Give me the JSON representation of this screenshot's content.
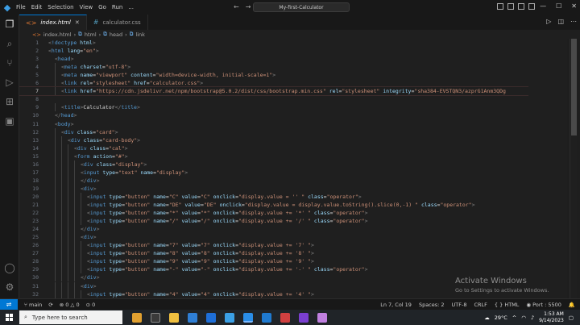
{
  "titlebar": {
    "menu": [
      "File",
      "Edit",
      "Selection",
      "View",
      "Go",
      "Run",
      "..."
    ],
    "search": "My-first-Calculator"
  },
  "tabs": [
    {
      "label": "index.html",
      "active": true
    },
    {
      "label": "calculator.css",
      "active": false
    }
  ],
  "breadcrumb": [
    "index.html",
    "html",
    "head",
    "link"
  ],
  "code_lines": [
    {
      "n": "1",
      "indent": 0,
      "html": "<span class='t'>&lt;</span><span class='tag'>!doctype</span> <span class='attr'>html</span><span class='t'>&gt;</span>"
    },
    {
      "n": "2",
      "indent": 0,
      "html": "<span class='t'>&lt;</span><span class='tag'>html</span> <span class='attr'>lang</span><span class='txt'>=</span><span class='str'>\"en\"</span><span class='t'>&gt;</span>"
    },
    {
      "n": "3",
      "indent": 1,
      "html": "<span class='t'>&lt;</span><span class='tag'>head</span><span class='t'>&gt;</span>"
    },
    {
      "n": "4",
      "indent": 2,
      "html": "<span class='t'>&lt;</span><span class='tag'>meta</span> <span class='attr'>charset</span><span class='txt'>=</span><span class='str'>\"utf-8\"</span><span class='t'>&gt;</span>"
    },
    {
      "n": "5",
      "indent": 2,
      "html": "<span class='t'>&lt;</span><span class='tag'>meta</span> <span class='attr'>name</span><span class='txt'>=</span><span class='str'>\"viewport\"</span> <span class='attr'>content</span><span class='txt'>=</span><span class='str'>\"width=device-width, initial-scale=1\"</span><span class='t'>&gt;</span>"
    },
    {
      "n": "6",
      "indent": 2,
      "html": "<span class='t'>&lt;</span><span class='tag'>link</span> <span class='attr'>rel</span><span class='txt'>=</span><span class='str'>\"stylesheet\"</span> <span class='attr'>href</span><span class='txt'>=</span><span class='str'>\"calculator.css\"</span><span class='t'>&gt;</span>"
    },
    {
      "n": "7",
      "indent": 2,
      "current": true,
      "html": "<span class='t'>&lt;</span><span class='tag'>link</span> <span class='attr'>href</span><span class='txt'>=</span><span class='str'>\"https://cdn.jsdelivr.net/npm/bootstrap@5.0.2/dist/css/bootstrap.min.css\"</span> <span class='attr'>rel</span><span class='txt'>=</span><span class='str'>\"stylesheet\"</span> <span class='attr'>integrity</span><span class='txt'>=</span><span class='str'>\"sha384-EVSTQN3/azprG1Anm3QDg</span>"
    },
    {
      "n": "8",
      "indent": 0,
      "html": ""
    },
    {
      "n": "9",
      "indent": 2,
      "html": "<span class='t'>&lt;</span><span class='tag'>title</span><span class='t'>&gt;</span><span class='txt'>Calculator</span><span class='t'>&lt;/</span><span class='tag'>title</span><span class='t'>&gt;</span>"
    },
    {
      "n": "10",
      "indent": 1,
      "html": "<span class='t'>&lt;/</span><span class='tag'>head</span><span class='t'>&gt;</span>"
    },
    {
      "n": "11",
      "indent": 1,
      "html": "<span class='t'>&lt;</span><span class='tag'>body</span><span class='t'>&gt;</span>"
    },
    {
      "n": "12",
      "indent": 2,
      "html": "<span class='t'>&lt;</span><span class='tag'>div</span> <span class='attr'>class</span><span class='txt'>=</span><span class='str'>\"card\"</span><span class='t'>&gt;</span>"
    },
    {
      "n": "13",
      "indent": 3,
      "html": "<span class='t'>&lt;</span><span class='tag'>div</span> <span class='attr'>class</span><span class='txt'>=</span><span class='str'>\"card-body\"</span><span class='t'>&gt;</span>"
    },
    {
      "n": "14",
      "indent": 4,
      "html": "<span class='t'>&lt;</span><span class='tag'>div</span> <span class='attr'>class</span><span class='txt'>=</span><span class='str'>\"cal\"</span><span class='t'>&gt;</span>"
    },
    {
      "n": "15",
      "indent": 4,
      "html": "<span class='t'>&lt;</span><span class='tag'>form</span> <span class='attr'>action</span><span class='txt'>=</span><span class='str'>\"#\"</span><span class='t'>&gt;</span>"
    },
    {
      "n": "16",
      "indent": 5,
      "html": "<span class='t'>&lt;</span><span class='tag'>div</span> <span class='attr'>class</span><span class='txt'>=</span><span class='str'>\"display\"</span><span class='t'>&gt;</span>"
    },
    {
      "n": "17",
      "indent": 5,
      "html": "<span class='t'>&lt;</span><span class='tag'>input</span> <span class='attr'>type</span><span class='txt'>=</span><span class='str'>\"text\"</span> <span class='attr'>name</span><span class='txt'>=</span><span class='str'>\"display\"</span><span class='t'>&gt;</span>"
    },
    {
      "n": "18",
      "indent": 5,
      "html": "<span class='t'>&lt;/</span><span class='tag'>div</span><span class='t'>&gt;</span>"
    },
    {
      "n": "19",
      "indent": 5,
      "html": "<span class='t'>&lt;</span><span class='tag'>div</span><span class='t'>&gt;</span>"
    },
    {
      "n": "20",
      "indent": 6,
      "html": "<span class='t'>&lt;</span><span class='tag'>input</span> <span class='attr'>type</span><span class='txt'>=</span><span class='str'>\"button\"</span> <span class='attr'>name</span><span class='txt'>=</span><span class='str'>\"C\"</span> <span class='attr'>value</span><span class='txt'>=</span><span class='str'>\"C\"</span> <span class='attr'>onclick</span><span class='txt'>=</span><span class='str'>\"display.value = '' \"</span> <span class='attr'>class</span><span class='txt'>=</span><span class='str'>\"operator\"</span><span class='t'>&gt;</span>"
    },
    {
      "n": "21",
      "indent": 6,
      "html": "<span class='t'>&lt;</span><span class='tag'>input</span> <span class='attr'>type</span><span class='txt'>=</span><span class='str'>\"button\"</span> <span class='attr'>name</span><span class='txt'>=</span><span class='str'>\"DE\"</span> <span class='attr'>value</span><span class='txt'>=</span><span class='str'>\"DE\"</span> <span class='attr'>onclick</span><span class='txt'>=</span><span class='str'>\"display.value = display.value.toString().slice(0,-1) \"</span> <span class='attr'>class</span><span class='txt'>=</span><span class='str'>\"operator\"</span><span class='t'>&gt;</span>"
    },
    {
      "n": "22",
      "indent": 6,
      "html": "<span class='t'>&lt;</span><span class='tag'>input</span> <span class='attr'>type</span><span class='txt'>=</span><span class='str'>\"button\"</span> <span class='attr'>name</span><span class='txt'>=</span><span class='str'>\"*\"</span> <span class='attr'>value</span><span class='txt'>=</span><span class='str'>\"*\"</span> <span class='attr'>onclick</span><span class='txt'>=</span><span class='str'>\"display.value += '*' \"</span> <span class='attr'>class</span><span class='txt'>=</span><span class='str'>\"operator\"</span><span class='t'>&gt;</span>"
    },
    {
      "n": "23",
      "indent": 6,
      "html": "<span class='t'>&lt;</span><span class='tag'>input</span> <span class='attr'>type</span><span class='txt'>=</span><span class='str'>\"button\"</span> <span class='attr'>name</span><span class='txt'>=</span><span class='str'>\"/\"</span> <span class='attr'>value</span><span class='txt'>=</span><span class='str'>\"/\"</span> <span class='attr'>onclick</span><span class='txt'>=</span><span class='str'>\"display.value += '/' \"</span> <span class='attr'>class</span><span class='txt'>=</span><span class='str'>\"operator\"</span><span class='t'>&gt;</span>"
    },
    {
      "n": "24",
      "indent": 5,
      "html": "<span class='t'>&lt;/</span><span class='tag'>div</span><span class='t'>&gt;</span>"
    },
    {
      "n": "25",
      "indent": 5,
      "html": "<span class='t'>&lt;</span><span class='tag'>div</span><span class='t'>&gt;</span>"
    },
    {
      "n": "26",
      "indent": 6,
      "html": "<span class='t'>&lt;</span><span class='tag'>input</span> <span class='attr'>type</span><span class='txt'>=</span><span class='str'>\"button\"</span> <span class='attr'>name</span><span class='txt'>=</span><span class='str'>\"7\"</span> <span class='attr'>value</span><span class='txt'>=</span><span class='str'>\"7\"</span> <span class='attr'>onclick</span><span class='txt'>=</span><span class='str'>\"display.value += '7' \"</span><span class='t'>&gt;</span>"
    },
    {
      "n": "27",
      "indent": 6,
      "html": "<span class='t'>&lt;</span><span class='tag'>input</span> <span class='attr'>type</span><span class='txt'>=</span><span class='str'>\"button\"</span> <span class='attr'>name</span><span class='txt'>=</span><span class='str'>\"8\"</span> <span class='attr'>value</span><span class='txt'>=</span><span class='str'>\"8\"</span> <span class='attr'>onclick</span><span class='txt'>=</span><span class='str'>\"display.value += '8' \"</span><span class='t'>&gt;</span>"
    },
    {
      "n": "28",
      "indent": 6,
      "html": "<span class='t'>&lt;</span><span class='tag'>input</span> <span class='attr'>type</span><span class='txt'>=</span><span class='str'>\"button\"</span> <span class='attr'>name</span><span class='txt'>=</span><span class='str'>\"9\"</span> <span class='attr'>value</span><span class='txt'>=</span><span class='str'>\"9\"</span> <span class='attr'>onclick</span><span class='txt'>=</span><span class='str'>\"display.value += '9' \"</span><span class='t'>&gt;</span>"
    },
    {
      "n": "29",
      "indent": 6,
      "html": "<span class='t'>&lt;</span><span class='tag'>input</span> <span class='attr'>type</span><span class='txt'>=</span><span class='str'>\"button\"</span> <span class='attr'>name</span><span class='txt'>=</span><span class='str'>\"-\"</span> <span class='attr'>value</span><span class='txt'>=</span><span class='str'>\"-\"</span> <span class='attr'>onclick</span><span class='txt'>=</span><span class='str'>\"display.value += '-' \"</span> <span class='attr'>class</span><span class='txt'>=</span><span class='str'>\"operator\"</span><span class='t'>&gt;</span>"
    },
    {
      "n": "30",
      "indent": 5,
      "html": "<span class='t'>&lt;/</span><span class='tag'>div</span><span class='t'>&gt;</span>"
    },
    {
      "n": "31",
      "indent": 5,
      "html": "<span class='t'>&lt;</span><span class='tag'>div</span><span class='t'>&gt;</span>"
    },
    {
      "n": "32",
      "indent": 6,
      "html": "<span class='t'>&lt;</span><span class='tag'>input</span> <span class='attr'>type</span><span class='txt'>=</span><span class='str'>\"button\"</span> <span class='attr'>name</span><span class='txt'>=</span><span class='str'>\"4\"</span> <span class='attr'>value</span><span class='txt'>=</span><span class='str'>\"4\"</span> <span class='attr'>onclick</span><span class='txt'>=</span><span class='str'>\"display.value += '4' \"</span><span class='t'>&gt;</span>"
    }
  ],
  "watermark": {
    "title": "Activate Windows",
    "subtitle": "Go to Settings to activate Windows."
  },
  "status": {
    "branch": "main",
    "sync": "⟳",
    "errors": "0",
    "warnings": "0",
    "ports": "0",
    "position": "Ln 7, Col 19",
    "spaces": "Spaces: 2",
    "encoding": "UTF-8",
    "eol": "CRLF",
    "language": "HTML",
    "port": "Port : 5500"
  },
  "taskbar": {
    "search_placeholder": "Type here to search",
    "weather": "29°C",
    "time": "1:53 AM",
    "date": "9/14/2023"
  },
  "colors": {
    "accent": "#0078d4",
    "tag": "#569cd6",
    "attr": "#9cdcfe",
    "string": "#ce9178"
  }
}
